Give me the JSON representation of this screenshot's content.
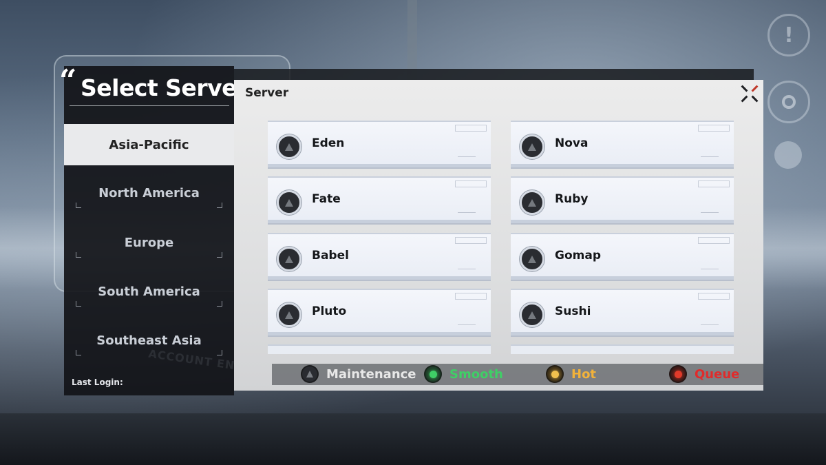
{
  "header": {
    "title": "Select Server",
    "panel_title": "Server"
  },
  "regions": [
    {
      "label": "Asia-Pacific",
      "active": true
    },
    {
      "label": "North America",
      "active": false
    },
    {
      "label": "Europe",
      "active": false
    },
    {
      "label": "South America",
      "active": false
    },
    {
      "label": "Southeast Asia",
      "active": false
    }
  ],
  "last_login": {
    "label": "Last Login:"
  },
  "background": {
    "account_entry": "ACCOUNT ENTRY"
  },
  "servers": [
    {
      "name": "Eden",
      "status": "maintenance"
    },
    {
      "name": "Nova",
      "status": "maintenance"
    },
    {
      "name": "Fate",
      "status": "maintenance"
    },
    {
      "name": "Ruby",
      "status": "maintenance"
    },
    {
      "name": "Babel",
      "status": "maintenance"
    },
    {
      "name": "Gomap",
      "status": "maintenance"
    },
    {
      "name": "Pluto",
      "status": "maintenance"
    },
    {
      "name": "Sushi",
      "status": "maintenance"
    }
  ],
  "legend": [
    {
      "label": "Maintenance",
      "color": "#e8e8e8",
      "dot": "#3a3c40"
    },
    {
      "label": "Smooth",
      "color": "#3fcf66",
      "dot": "#3fcf66"
    },
    {
      "label": "Hot",
      "color": "#f2b23a",
      "dot": "#f2c14e"
    },
    {
      "label": "Queue",
      "color": "#e02b2b",
      "dot": "#e03a2a"
    }
  ],
  "icons": {
    "close": "close-icon",
    "status": "status-triangle-icon",
    "side": [
      "alert-icon",
      "settings-icon",
      "account-icon"
    ]
  }
}
